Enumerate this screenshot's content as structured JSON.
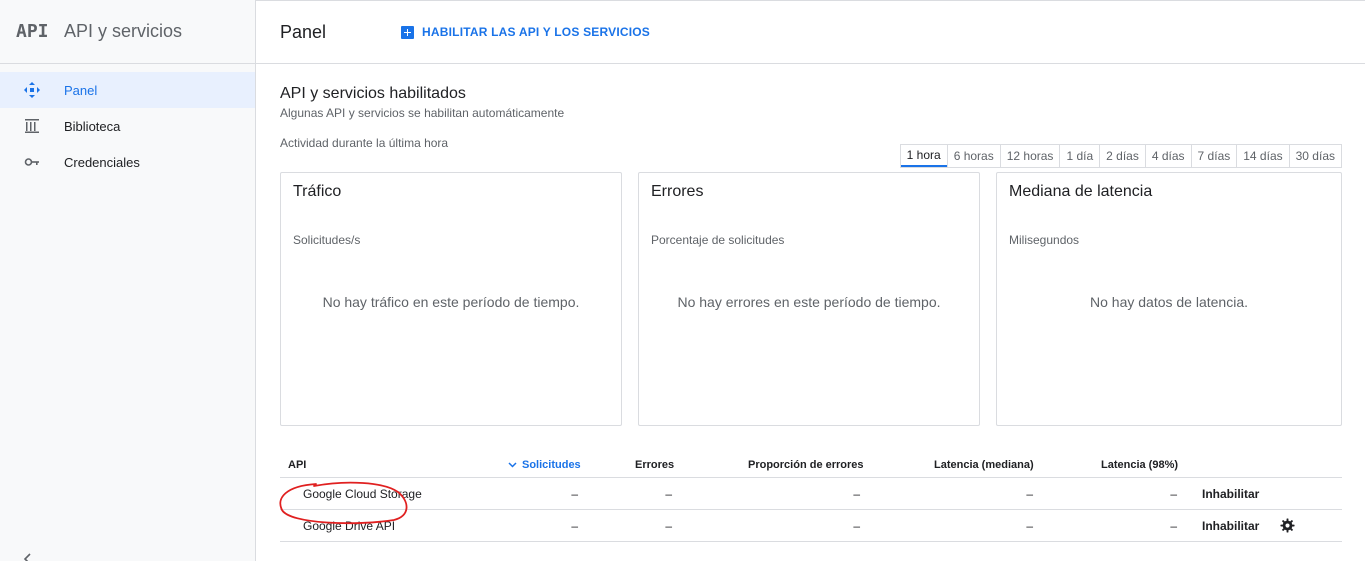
{
  "sidebar": {
    "logo": "API",
    "title": "API y servicios",
    "items": [
      {
        "label": "Panel",
        "icon": "dashboard-icon",
        "active": true
      },
      {
        "label": "Biblioteca",
        "icon": "library-icon",
        "active": false
      },
      {
        "label": "Credenciales",
        "icon": "key-icon",
        "active": false
      }
    ]
  },
  "topbar": {
    "title": "Panel",
    "enable_label": "HABILITAR LAS API Y LOS SERVICIOS"
  },
  "main": {
    "section_title": "API y servicios habilitados",
    "section_subtitle": "Algunas API y servicios se habilitan automáticamente",
    "activity_label": "Actividad durante la última hora",
    "time_ranges": [
      "1 hora",
      "6 horas",
      "12 horas",
      "1 día",
      "2 días",
      "4 días",
      "7 días",
      "14 días",
      "30 días"
    ],
    "selected_range": "1 hora",
    "cards": [
      {
        "title": "Tráfico",
        "subtitle": "Solicitudes/s",
        "empty": "No hay tráfico en este período de tiempo."
      },
      {
        "title": "Errores",
        "subtitle": "Porcentaje de solicitudes",
        "empty": "No hay errores en este período de tiempo."
      },
      {
        "title": "Mediana de latencia",
        "subtitle": "Milisegundos",
        "empty": "No hay datos de latencia."
      }
    ]
  },
  "table": {
    "headers": {
      "api": "API",
      "requests": "Solicitudes",
      "errors": "Errores",
      "error_ratio": "Proporción de errores",
      "latency_median": "Latencia (mediana)",
      "latency_98": "Latencia (98%)"
    },
    "rows": [
      {
        "name": "Google Cloud Storage",
        "requests": "–",
        "errors": "–",
        "error_ratio": "–",
        "latency_median": "–",
        "latency_98": "–",
        "action": "Inhabilitar"
      },
      {
        "name": "Google Drive API",
        "requests": "–",
        "errors": "–",
        "error_ratio": "–",
        "latency_median": "–",
        "latency_98": "–",
        "action": "Inhabilitar"
      }
    ]
  },
  "colors": {
    "accent": "#1a73e8",
    "active_bg": "#e8f0fe",
    "annotation": "#e02020"
  }
}
